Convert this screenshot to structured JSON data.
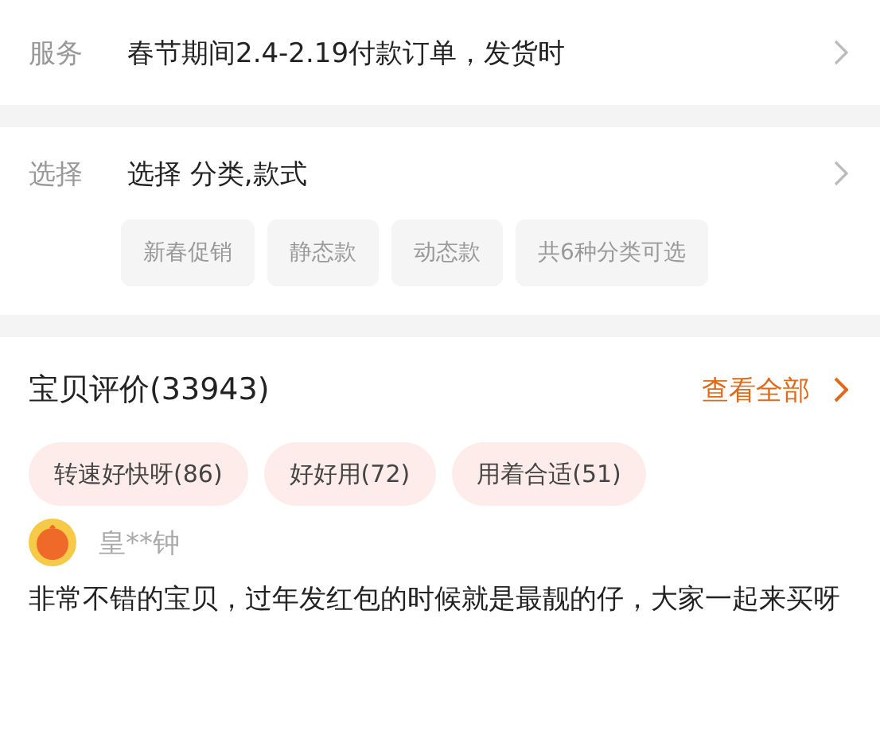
{
  "service": {
    "label": "服务",
    "value": "春节期间2.4-2.19付款订单，发货时"
  },
  "select": {
    "label": "选择",
    "value": "选择 分类,款式",
    "options": [
      "新春促销",
      "静态款",
      "动态款",
      "共6种分类可选"
    ]
  },
  "reviews": {
    "title": "宝贝评价(33943)",
    "view_all": "查看全部",
    "tags": [
      "转速好快呀(86)",
      "好好用(72)",
      "用着合适(51)"
    ],
    "review": {
      "user": "皇**钟",
      "text": "非常不错的宝贝，过年发红包的时候就是最靓的仔，大家一起来买呀"
    }
  }
}
